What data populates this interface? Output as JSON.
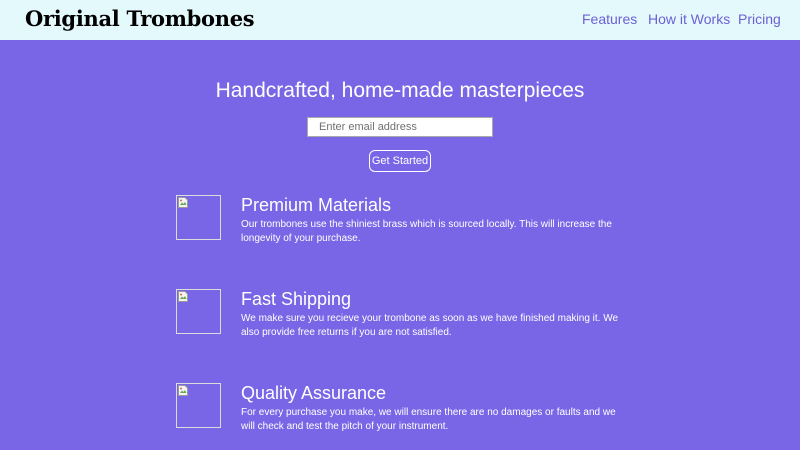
{
  "header": {
    "logo": "Original Trombones",
    "nav": {
      "features": "Features",
      "how_it_works": "How it Works",
      "pricing": "Pricing"
    }
  },
  "hero": {
    "title": "Handcrafted, home-made masterpieces",
    "email_placeholder": "Enter email address",
    "email_value": "",
    "button_label": "Get Started"
  },
  "features": [
    {
      "icon": "broken-image-icon",
      "title": "Premium Materials",
      "description": "Our trombones use the shiniest brass which is sourced locally. This will increase the longevity of your purchase."
    },
    {
      "icon": "broken-image-icon",
      "title": "Fast Shipping",
      "description": "We make sure you recieve your trombone as soon as we have finished making it. We also provide free returns if you are not satisfied."
    },
    {
      "icon": "broken-image-icon",
      "title": "Quality Assurance",
      "description": "For every purchase you make, we will ensure there are no damages or faults and we will check and test the pitch of your instrument."
    }
  ],
  "colors": {
    "background": "#7866e6",
    "header_background": "#e3f9fb",
    "nav_link": "#6e5fd4",
    "text": "#ffffff"
  }
}
